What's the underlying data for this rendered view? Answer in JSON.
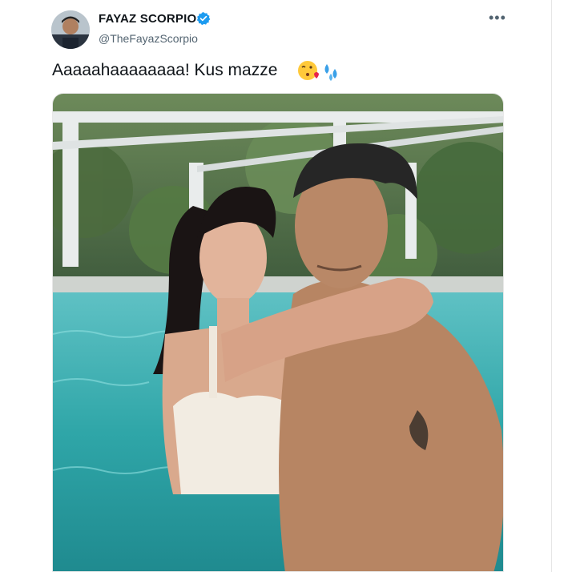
{
  "tweet": {
    "display_name": "FAYAZ SCORPIO",
    "handle": "@TheFayazScorpio",
    "text": "Aaaaahaaaaaaaa! Kus mazze",
    "emojis": [
      "face-throwing-kiss",
      "sweat-droplets"
    ]
  },
  "icons": {
    "verified": "verified-badge-icon",
    "more": "more-options-icon"
  },
  "colors": {
    "verified_blue": "#1d9bf0",
    "text_primary": "#0f1419",
    "text_secondary": "#536471",
    "pool_water": "#2fa6a8"
  }
}
